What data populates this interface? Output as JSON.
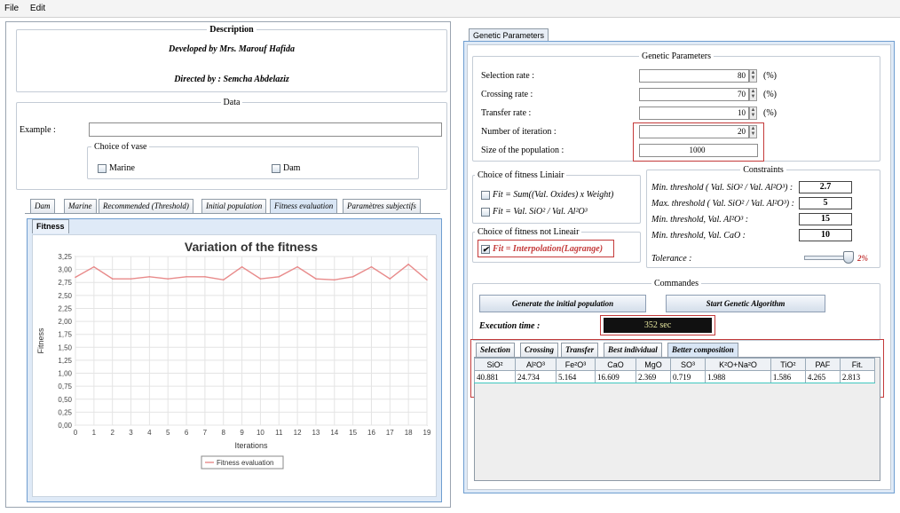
{
  "menu": {
    "file": "File",
    "edit": "Edit"
  },
  "description": {
    "legend": "Description",
    "developed_by": "Developed by Mrs. Marouf Hafida",
    "directed_by": "Directed by : Semcha Abdelaziz"
  },
  "data_section": {
    "legend": "Data",
    "example_label": "Example :",
    "example_value": "",
    "vase_legend": "Choice of vase",
    "marine": "Marine",
    "dam": "Dam"
  },
  "left_tabs": [
    "Dam",
    "Marine",
    "Recommended (Threshold)",
    "Initial population",
    "Fitness evaluation",
    "Paramètres subjectifs"
  ],
  "fitness_tab": "Fitness",
  "chart_data": {
    "type": "line",
    "title": "Variation of the fitness",
    "xlabel": "Iterations",
    "ylabel": "Fitness",
    "x": [
      0,
      1,
      2,
      3,
      4,
      5,
      6,
      7,
      8,
      9,
      10,
      11,
      12,
      13,
      14,
      15,
      16,
      17,
      18,
      19
    ],
    "series": [
      {
        "name": "Fitness evaluation",
        "color": "#e88a8a",
        "values": [
          2.85,
          3.05,
          2.82,
          2.82,
          2.86,
          2.82,
          2.86,
          2.86,
          2.8,
          3.05,
          2.82,
          2.86,
          3.05,
          2.82,
          2.8,
          2.86,
          3.05,
          2.82,
          3.1,
          2.8
        ]
      }
    ],
    "xlim": [
      0,
      19
    ],
    "ylim": [
      0,
      3.25
    ],
    "yticks": [
      "0,00",
      "0,25",
      "0,50",
      "0,75",
      "1,00",
      "1,25",
      "1,50",
      "1,75",
      "2,00",
      "2,25",
      "2,50",
      "2,75",
      "3,00",
      "3,25"
    ],
    "grid": true,
    "legend": "bottom-center"
  },
  "right_tab": "Genetic Parameters",
  "genetic": {
    "legend": "Genetic Parameters",
    "selection_label": "Selection rate :",
    "selection_value": "80",
    "crossing_label": "Crossing rate :",
    "crossing_value": "70",
    "transfer_label": "Transfer rate :",
    "transfer_value": "10",
    "iteration_label": "Number of iteration :",
    "iteration_value": "20",
    "population_label": "Size of the population :",
    "population_value": "1000",
    "unit": "(%)"
  },
  "fitness_choice": {
    "linear_legend": "Choice of fitness Liniair",
    "opt1": "Fit = Sum((Val. Oxides) x Weight)",
    "opt2": "Fit = Val. SiO² / Val. Al²O³",
    "nonlinear_legend": "Choice of fitness not Lineair",
    "opt3": "Fit = Interpolation(Lagrange)"
  },
  "constraints": {
    "legend": "Constraints",
    "min_ratio_label": "Min. threshold ( Val. SiO² / Val. Al²O³) :",
    "min_ratio_value": "2.7",
    "max_ratio_label": "Max. threshold ( Val. SiO² / Val. Al²O³) :",
    "max_ratio_value": "5",
    "min_al_label": "Min. threshold, Val. Al²O³ :",
    "min_al_value": "15",
    "min_cao_label": "Min. threshold, Val. CaO :",
    "min_cao_value": "10",
    "tolerance_label": "Tolerance :",
    "tolerance_value": "2%"
  },
  "commands": {
    "legend": "Commandes",
    "generate": "Generate the initial population",
    "start": "Start Genetic Algorithm",
    "exec_label": "Execution time :",
    "exec_value": "352 sec"
  },
  "result_tabs": [
    "Selection",
    "Crossing",
    "Transfer",
    "Best individual",
    "Better composition"
  ],
  "result_table": {
    "headers": [
      "SiO²",
      "Al²O³",
      "Fe²O³",
      "CaO",
      "MgO",
      "SO³",
      "K²O+Na²O",
      "TiO²",
      "PAF",
      "Fit."
    ],
    "row": [
      "40.881",
      "24.734",
      "5.164",
      "16.609",
      "2.369",
      "0.719",
      "1.988",
      "1.586",
      "4.265",
      "2.813"
    ]
  }
}
